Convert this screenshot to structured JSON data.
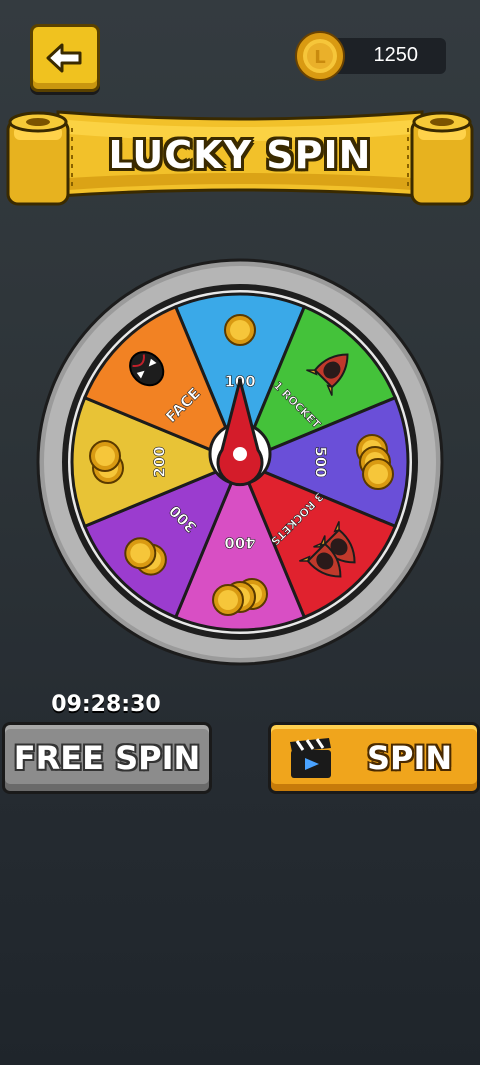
{
  "header": {
    "back_icon": "left-arrow-icon",
    "coins": "1250",
    "coin_icon": "gold-coin-icon"
  },
  "title": "LUCKY SPIN",
  "wheel": {
    "segments": [
      {
        "label": "100",
        "color": "#3aa9e8",
        "icon": "coin-icon"
      },
      {
        "label": "1 ROCKET",
        "color": "#44c23a",
        "icon": "rocket-icon"
      },
      {
        "label": "500",
        "color": "#6a4fd8",
        "icon": "coin-stack-icon"
      },
      {
        "label": "3 ROCKETS",
        "color": "#e0222e",
        "icon": "rockets-icon"
      },
      {
        "label": "400",
        "color": "#d84fc4",
        "icon": "coin-pile-icon"
      },
      {
        "label": "300",
        "color": "#9b3ccf",
        "icon": "coins-icon"
      },
      {
        "label": "200",
        "color": "#e8c336",
        "icon": "coins-icon"
      },
      {
        "label": "FACE",
        "color": "#f28223",
        "icon": "face-mask-icon"
      }
    ],
    "pointer_icon": "spinner-pointer-icon"
  },
  "timer": "09:28:30",
  "buttons": {
    "free_spin": "FREE SPIN",
    "spin": "SPIN",
    "spin_icon": "clapperboard-icon"
  }
}
